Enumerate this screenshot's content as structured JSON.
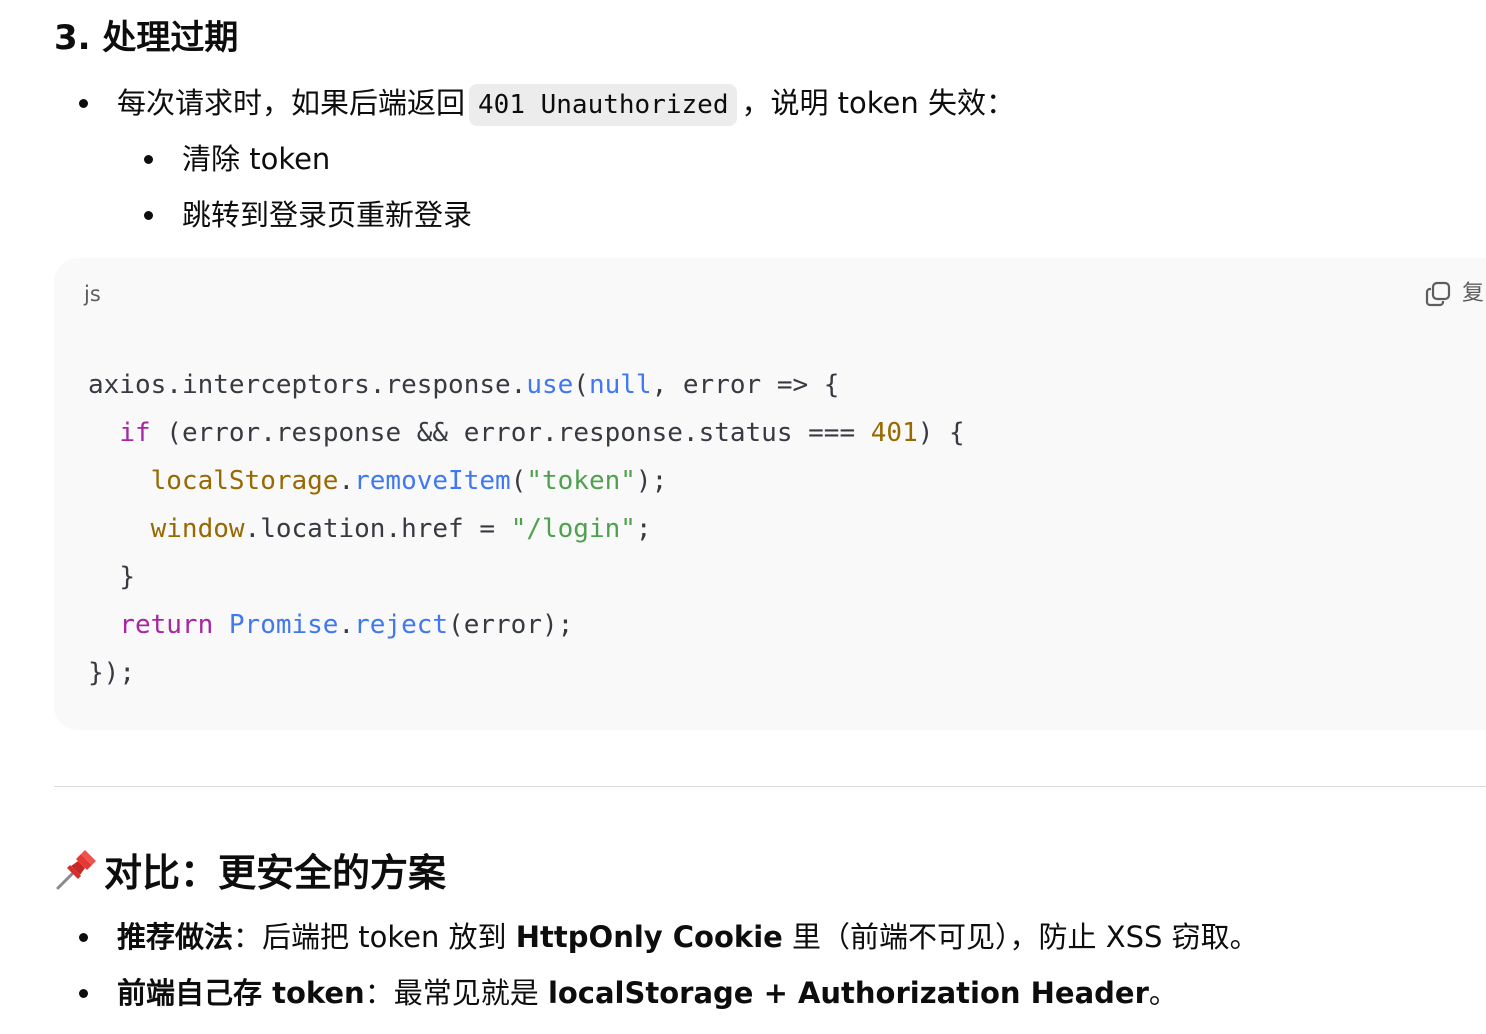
{
  "section3": {
    "heading": "3. 处理过期",
    "bullet1": {
      "prefix": "每次请求时，如果后端返回",
      "code": "401 Unauthorized",
      "suffix": "，说明 token 失效："
    },
    "sub_bullets": [
      "清除 token",
      "跳转到登录页重新登录"
    ]
  },
  "codeblock": {
    "lang": "js",
    "copy_label": "复",
    "lines": [
      "axios.interceptors.response.use(null, error => {",
      "  if (error.response && error.response.status === 401) {",
      "    localStorage.removeItem(\"token\");",
      "    window.location.href = \"/login\";",
      "  }",
      "  return Promise.reject(error);",
      "});"
    ]
  },
  "comparison": {
    "icon": "pushpin-icon",
    "heading": "对比：更安全的方案",
    "bullet1": {
      "bold1": "推荐做法",
      "text1": "：后端把 token 放到 ",
      "bold2": "HttpOnly Cookie",
      "text2": " 里（前端不可见），防止 XSS 窃取。"
    },
    "bullet2": {
      "bold1": "前端自己存 token",
      "text1": "：最常见就是 ",
      "bold2": "localStorage + Authorization Header",
      "text2": "。"
    }
  },
  "colors": {
    "keyword": "#a626a4",
    "function": "#4078f2",
    "number": "#986801",
    "string": "#50a14f",
    "code_bg": "#f9f9f9",
    "inline_code_bg": "#ececec"
  }
}
